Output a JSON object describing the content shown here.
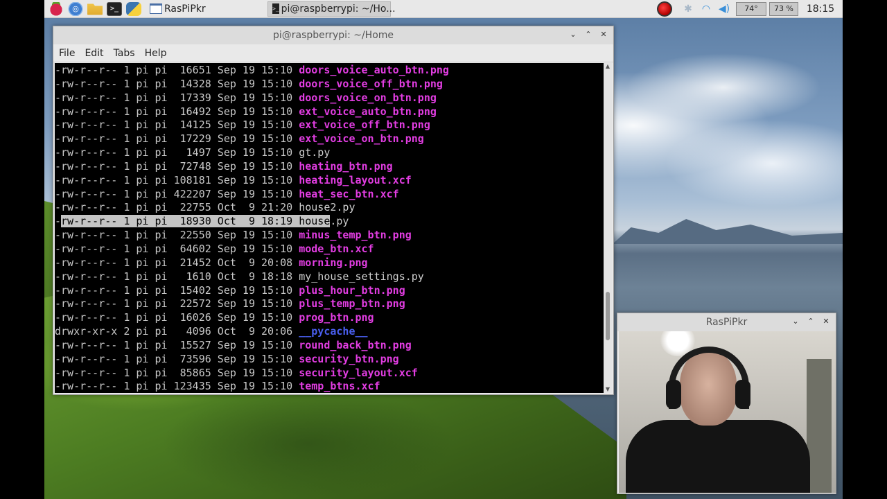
{
  "taskbar": {
    "launchers": [
      {
        "name": "raspberry-menu-icon",
        "glyph": ""
      },
      {
        "name": "web-browser-icon",
        "glyph": "◎"
      },
      {
        "name": "file-manager-icon",
        "glyph": ""
      },
      {
        "name": "terminal-launcher-icon",
        "glyph": ">_"
      },
      {
        "name": "python-ide-icon",
        "glyph": ""
      }
    ],
    "tasks": [
      {
        "label": "RasPiPkr",
        "icon": "window-icon"
      },
      {
        "label": "pi@raspberrypi: ~/Ho...",
        "icon": "terminal-icon"
      }
    ],
    "tray": {
      "bluetooth_glyph": "✱",
      "wifi_glyph": "◠",
      "volume_glyph": "◀)",
      "temperature": "74°",
      "cpu": "73 %",
      "clock": "18:15"
    }
  },
  "terminal": {
    "title": "pi@raspberrypi: ~/Home",
    "menu": [
      "File",
      "Edit",
      "Tabs",
      "Help"
    ],
    "rows": [
      {
        "meta": "-rw-r--r-- 1 pi pi  16651 Sep 19 15:10 ",
        "name": "doors_voice_auto_btn.png",
        "kind": "image"
      },
      {
        "meta": "-rw-r--r-- 1 pi pi  14328 Sep 19 15:10 ",
        "name": "doors_voice_off_btn.png",
        "kind": "image"
      },
      {
        "meta": "-rw-r--r-- 1 pi pi  17339 Sep 19 15:10 ",
        "name": "doors_voice_on_btn.png",
        "kind": "image"
      },
      {
        "meta": "-rw-r--r-- 1 pi pi  16492 Sep 19 15:10 ",
        "name": "ext_voice_auto_btn.png",
        "kind": "image"
      },
      {
        "meta": "-rw-r--r-- 1 pi pi  14125 Sep 19 15:10 ",
        "name": "ext_voice_off_btn.png",
        "kind": "image"
      },
      {
        "meta": "-rw-r--r-- 1 pi pi  17229 Sep 19 15:10 ",
        "name": "ext_voice_on_btn.png",
        "kind": "image"
      },
      {
        "meta": "-rw-r--r-- 1 pi pi   1497 Sep 19 15:10 ",
        "name": "gt.py",
        "kind": "file"
      },
      {
        "meta": "-rw-r--r-- 1 pi pi  72748 Sep 19 15:10 ",
        "name": "heating_btn.png",
        "kind": "image"
      },
      {
        "meta": "-rw-r--r-- 1 pi pi 108181 Sep 19 15:10 ",
        "name": "heating_layout.xcf",
        "kind": "image"
      },
      {
        "meta": "-rw-r--r-- 1 pi pi 422207 Sep 19 15:10 ",
        "name": "heat_sec_btn.xcf",
        "kind": "image"
      },
      {
        "meta": "-rw-r--r-- 1 pi pi  22755 Oct  9 21:20 ",
        "name": "house2.py",
        "kind": "file"
      },
      {
        "meta": "-rw-r--r-- 1 pi pi  18930 Oct  9 18:19 ",
        "name": "house.py",
        "kind": "file",
        "selected": true,
        "sel_prefix": "-",
        "sel_text": "rw-r--r-- 1 pi pi  18930 Oct  9 18:19 house",
        "sel_suffix": ".py"
      },
      {
        "meta": "-rw-r--r-- 1 pi pi  22550 Sep 19 15:10 ",
        "name": "minus_temp_btn.png",
        "kind": "image"
      },
      {
        "meta": "-rw-r--r-- 1 pi pi  64602 Sep 19 15:10 ",
        "name": "mode_btn.xcf",
        "kind": "image"
      },
      {
        "meta": "-rw-r--r-- 1 pi pi  21452 Oct  9 20:08 ",
        "name": "morning.png",
        "kind": "image"
      },
      {
        "meta": "-rw-r--r-- 1 pi pi   1610 Oct  9 18:18 ",
        "name": "my_house_settings.py",
        "kind": "file"
      },
      {
        "meta": "-rw-r--r-- 1 pi pi  15402 Sep 19 15:10 ",
        "name": "plus_hour_btn.png",
        "kind": "image"
      },
      {
        "meta": "-rw-r--r-- 1 pi pi  22572 Sep 19 15:10 ",
        "name": "plus_temp_btn.png",
        "kind": "image"
      },
      {
        "meta": "-rw-r--r-- 1 pi pi  16026 Sep 19 15:10 ",
        "name": "prog_btn.png",
        "kind": "image"
      },
      {
        "meta": "drwxr-xr-x 2 pi pi   4096 Oct  9 20:06 ",
        "name": "__pycache__",
        "kind": "dir"
      },
      {
        "meta": "-rw-r--r-- 1 pi pi  15527 Sep 19 15:10 ",
        "name": "round_back_btn.png",
        "kind": "image"
      },
      {
        "meta": "-rw-r--r-- 1 pi pi  73596 Sep 19 15:10 ",
        "name": "security_btn.png",
        "kind": "image"
      },
      {
        "meta": "-rw-r--r-- 1 pi pi  85865 Sep 19 15:10 ",
        "name": "security_layout.xcf",
        "kind": "image"
      },
      {
        "meta": "-rw-r--r-- 1 pi pi 123435 Sep 19 15:10 ",
        "name": "temp_btns.xcf",
        "kind": "image"
      }
    ]
  },
  "camera_window": {
    "title": "RasPiPkr"
  },
  "colors": {
    "image_file": "#e23de2",
    "directory": "#4a5ff0",
    "plain_file": "#cfcfcf",
    "terminal_bg": "#000000",
    "selection": "#c4c4c4"
  }
}
